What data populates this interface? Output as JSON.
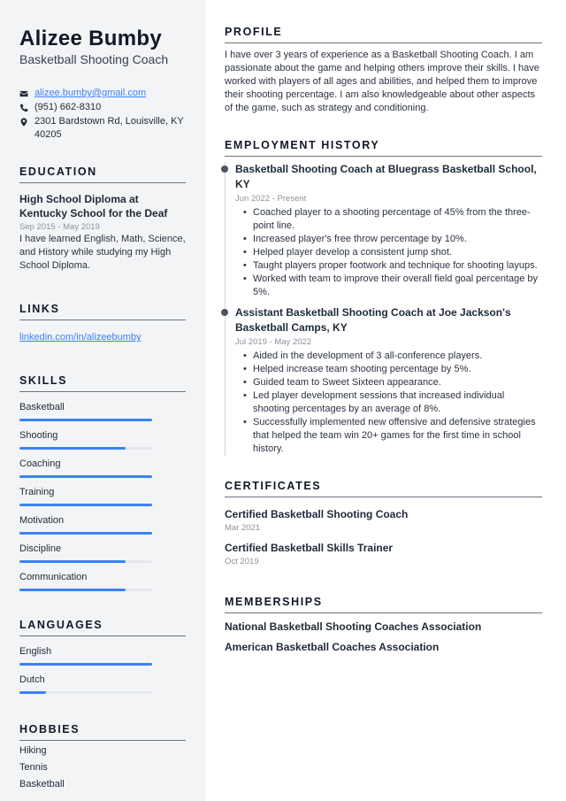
{
  "header": {
    "name": "Alizee Bumby",
    "title": "Basketball Shooting Coach"
  },
  "contact": {
    "email": "alizee.bumby@gmail.com",
    "phone": "(951) 662-8310",
    "address": "2301 Bardstown Rd, Louisville, KY 40205",
    "icons": {
      "email": "envelope-icon",
      "phone": "phone-icon",
      "address": "map-pin-icon"
    }
  },
  "education": {
    "heading": "EDUCATION",
    "items": [
      {
        "title": "High School Diploma at Kentucky School for the Deaf",
        "dates": "Sep 2015 - May 2019",
        "description": "I have learned English, Math, Science, and History while studying my High School Diploma."
      }
    ]
  },
  "links": {
    "heading": "LINKS",
    "items": [
      {
        "label": "linkedin.com/in/alizeebumby"
      }
    ]
  },
  "skills": {
    "heading": "SKILLS",
    "items": [
      {
        "name": "Basketball",
        "level": 1.0
      },
      {
        "name": "Shooting",
        "level": 0.8
      },
      {
        "name": "Coaching",
        "level": 1.0
      },
      {
        "name": "Training",
        "level": 1.0
      },
      {
        "name": "Motivation",
        "level": 1.0
      },
      {
        "name": "Discipline",
        "level": 0.8
      },
      {
        "name": "Communication",
        "level": 0.8
      }
    ]
  },
  "languages": {
    "heading": "LANGUAGES",
    "items": [
      {
        "name": "English",
        "level": 1.0
      },
      {
        "name": "Dutch",
        "level": 0.2
      }
    ]
  },
  "hobbies": {
    "heading": "HOBBIES",
    "items": [
      "Hiking",
      "Tennis",
      "Basketball"
    ]
  },
  "profile": {
    "heading": "PROFILE",
    "text": "I have over 3 years of experience as a Basketball Shooting Coach. I am passionate about the game and helping others improve their skills. I have worked with players of all ages and abilities, and helped them to improve their shooting percentage. I am also knowledgeable about other aspects of the game, such as strategy and conditioning."
  },
  "employment": {
    "heading": "EMPLOYMENT HISTORY",
    "jobs": [
      {
        "title": "Basketball Shooting Coach at Bluegrass Basketball School, KY",
        "dates": "Jun 2022 - Present",
        "bullets": [
          "Coached player to a shooting percentage of 45% from the three-point line.",
          "Increased player's free throw percentage by 10%.",
          "Helped player develop a consistent jump shot.",
          "Taught players proper footwork and technique for shooting layups.",
          "Worked with team to improve their overall field goal percentage by 5%."
        ]
      },
      {
        "title": "Assistant Basketball Shooting Coach at Joe Jackson's Basketball Camps, KY",
        "dates": "Jul 2019 - May 2022",
        "bullets": [
          "Aided in the development of 3 all-conference players.",
          "Helped increase team shooting percentage by 5%.",
          "Guided team to Sweet Sixteen appearance.",
          "Led player development sessions that increased individual shooting percentages by an average of 8%.",
          "Successfully implemented new offensive and defensive strategies that helped the team win 20+ games for the first time in school history."
        ]
      }
    ]
  },
  "certificates": {
    "heading": "CERTIFICATES",
    "items": [
      {
        "title": "Certified Basketball Shooting Coach",
        "date": "Mar 2021"
      },
      {
        "title": "Certified Basketball Skills Trainer",
        "date": "Oct 2019"
      }
    ]
  },
  "memberships": {
    "heading": "MEMBERSHIPS",
    "items": [
      "National Basketball Shooting Coaches Association",
      "American Basketball Coaches Association"
    ]
  },
  "colors": {
    "accent": "#3b82f6",
    "sidebar_bg": "#f3f4f6",
    "text": "#1f2937",
    "muted": "#8b929c"
  }
}
